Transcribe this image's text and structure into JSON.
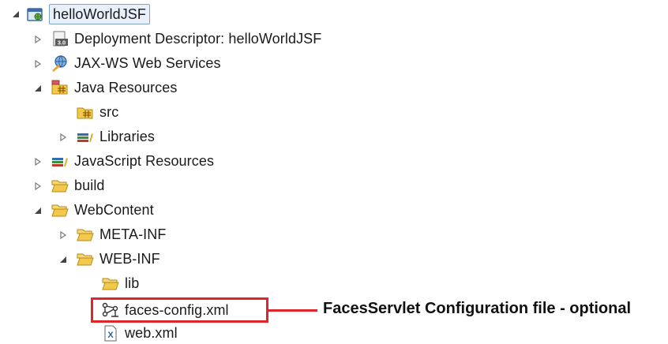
{
  "tree": {
    "root": "helloWorldJSF",
    "deployment_descriptor": "Deployment Descriptor: helloWorldJSF",
    "jaxws": "JAX-WS Web Services",
    "java_resources": "Java Resources",
    "src": "src",
    "libraries": "Libraries",
    "javascript_resources": "JavaScript Resources",
    "build": "build",
    "webcontent": "WebContent",
    "meta_inf": "META-INF",
    "web_inf": "WEB-INF",
    "lib": "lib",
    "faces_config": "faces-config.xml",
    "web_xml": "web.xml"
  },
  "callout": {
    "text": "FacesServlet Configuration file - optional",
    "color": "#e0242b"
  },
  "icons": {
    "root": "web-project-icon",
    "deployment_descriptor": "deployment-descriptor-icon",
    "jaxws": "web-services-icon",
    "java_resources": "java-resources-icon",
    "src": "source-folder-icon",
    "libraries": "libraries-icon",
    "javascript_resources": "javascript-resources-icon",
    "folder": "folder-icon",
    "faces_config": "faces-config-icon",
    "web_xml": "xml-file-icon"
  },
  "deployment_descriptor_badge": "3.0"
}
